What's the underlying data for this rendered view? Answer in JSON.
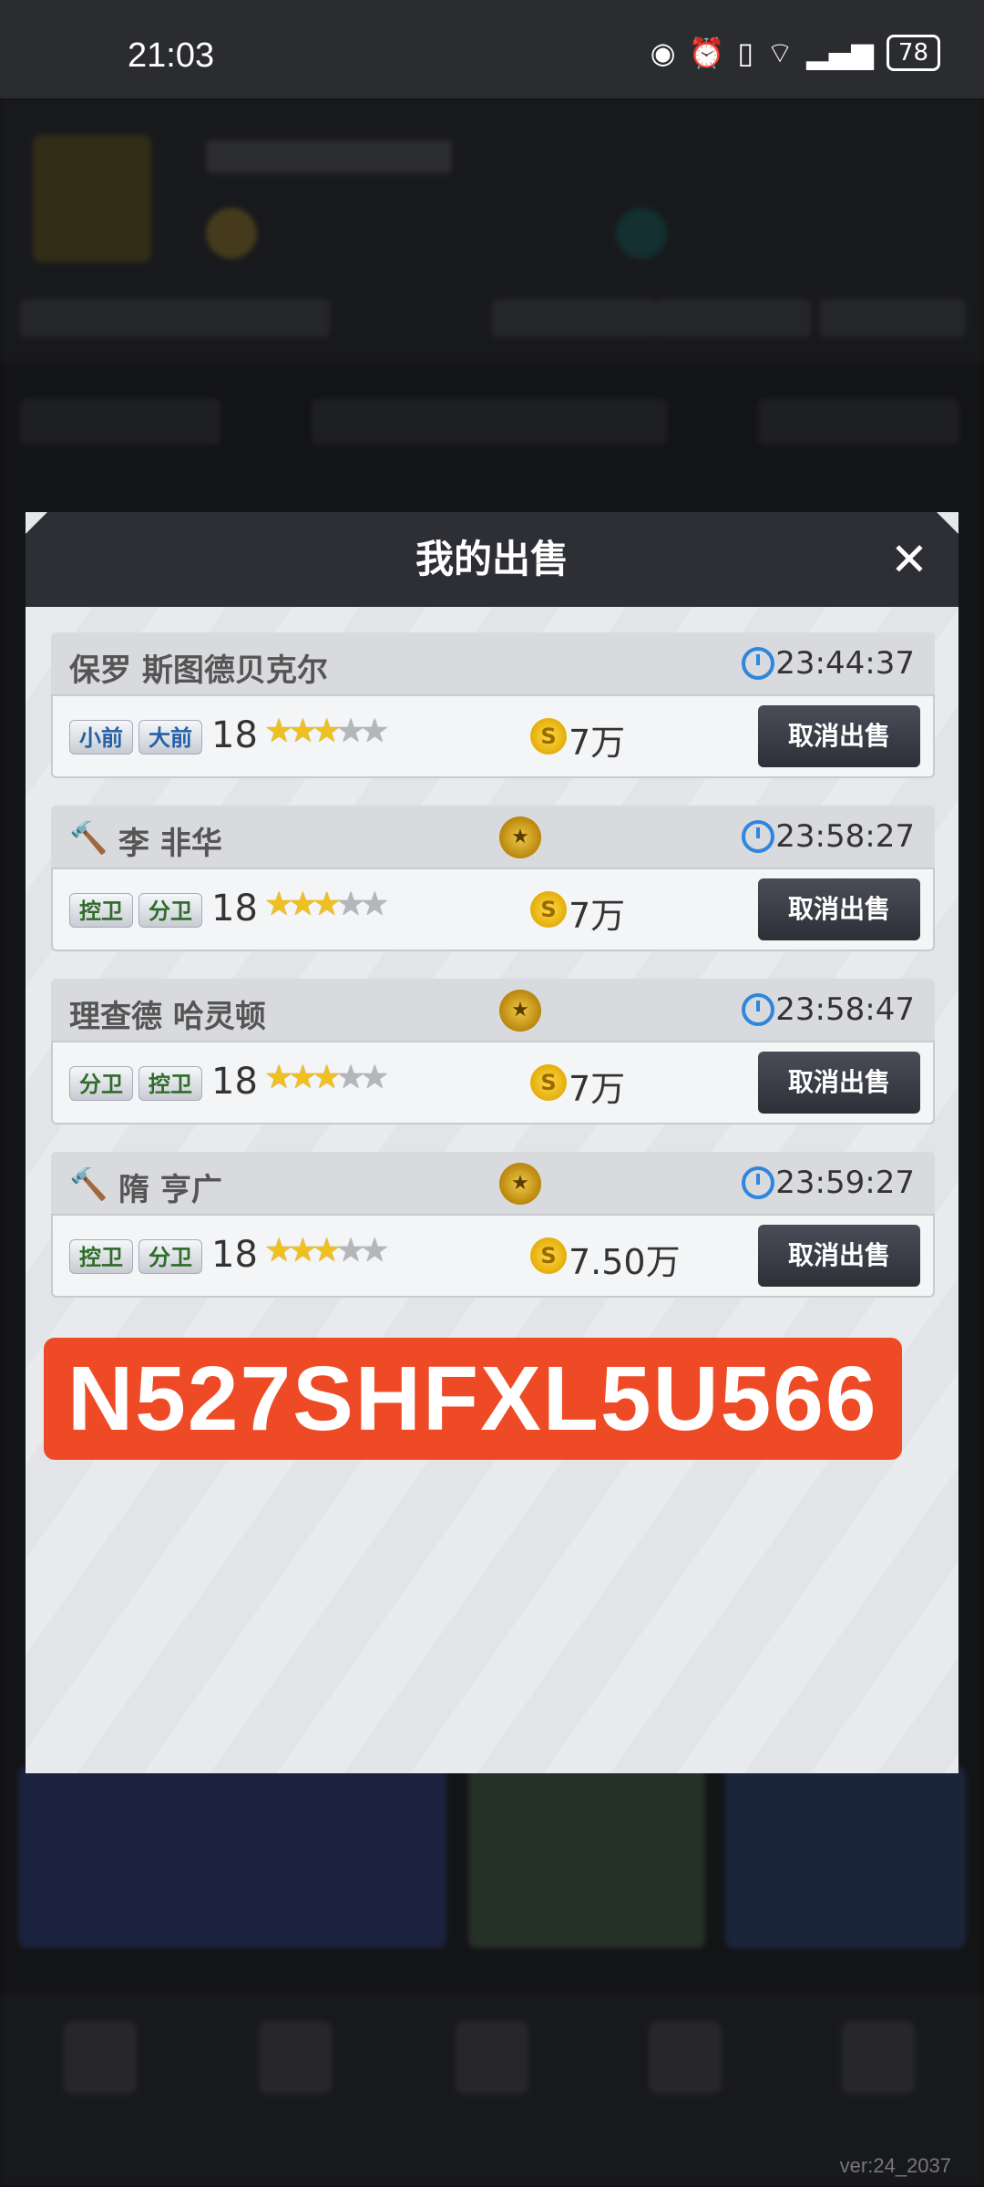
{
  "status_bar": {
    "time": "21:03",
    "battery": "78"
  },
  "dialog": {
    "title": "我的出售",
    "close_label": "✕",
    "entries": [
      {
        "name": "保罗 斯图德贝克尔",
        "time": "23:44:37",
        "positions": [
          "小前",
          "大前"
        ],
        "level": "18",
        "price": "7万",
        "stars_filled": 3,
        "stars_total": 5,
        "cancel_label": "取消出售"
      },
      {
        "name": "李 非华",
        "time": "23:58:27",
        "positions": [
          "控卫",
          "分卫"
        ],
        "level": "18",
        "price": "7万",
        "stars_filled": 3,
        "stars_total": 5,
        "cancel_label": "取消出售"
      },
      {
        "name": "理查德 哈灵顿",
        "time": "23:58:47",
        "positions": [
          "分卫",
          "控卫"
        ],
        "level": "18",
        "price": "7万",
        "stars_filled": 3,
        "stars_total": 5,
        "cancel_label": "取消出售"
      },
      {
        "name": "隋 亨广",
        "time": "23:59:27",
        "positions": [
          "控卫",
          "分卫"
        ],
        "level": "18",
        "price": "7.50万",
        "stars_filled": 3,
        "stars_total": 5,
        "cancel_label": "取消出售"
      }
    ]
  },
  "watermark": "N527SHFXL5U566",
  "version": "ver:24_2037",
  "colors": {
    "watermark_bg": "#ee4a26",
    "timer_blue": "#2e86de",
    "header_dark": "#2d2f35"
  }
}
